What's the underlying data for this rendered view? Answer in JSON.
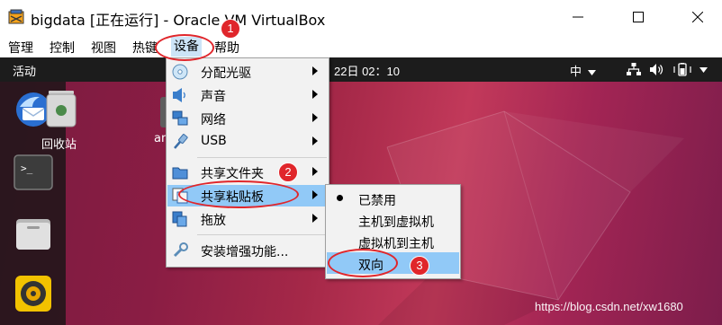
{
  "window": {
    "title": "bigdata [正在运行] - Oracle VM VirtualBox",
    "icon": "virtualbox-icon"
  },
  "menubar": {
    "items": [
      "管理",
      "控制",
      "视图",
      "热键",
      "设备",
      "帮助"
    ]
  },
  "guest": {
    "activities": "活动",
    "clock": "22日  02：10",
    "input_method": "中",
    "trash_label": "回收站",
    "partial_label": "an"
  },
  "devices_menu": {
    "items": [
      {
        "label": "分配光驱",
        "icon": "optical-disc-icon",
        "submenu": true
      },
      {
        "label": "声音",
        "icon": "audio-icon",
        "submenu": true
      },
      {
        "label": "网络",
        "icon": "network-icon",
        "submenu": true
      },
      {
        "label": "USB",
        "icon": "usb-icon",
        "submenu": true
      },
      {
        "label": "共享文件夹",
        "icon": "shared-folder-icon",
        "submenu": true
      },
      {
        "label": "共享粘贴板",
        "icon": "clipboard-icon",
        "submenu": true
      },
      {
        "label": "拖放",
        "icon": "drag-drop-icon",
        "submenu": true
      },
      {
        "label": "安装增强功能...",
        "icon": "guest-additions-icon",
        "submenu": false
      }
    ]
  },
  "clipboard_menu": {
    "items": [
      {
        "label": "已禁用",
        "checked": true
      },
      {
        "label": "主机到虚拟机",
        "checked": false
      },
      {
        "label": "虚拟机到主机",
        "checked": false
      },
      {
        "label": "双向",
        "checked": false
      }
    ]
  },
  "annotations": [
    "1",
    "2",
    "3"
  ],
  "watermark": "https://blog.csdn.net/xw1680",
  "colors": {
    "highlight": "#91c9f7",
    "annotation": "#e0262b",
    "menubar_active": "#cce4f7"
  }
}
